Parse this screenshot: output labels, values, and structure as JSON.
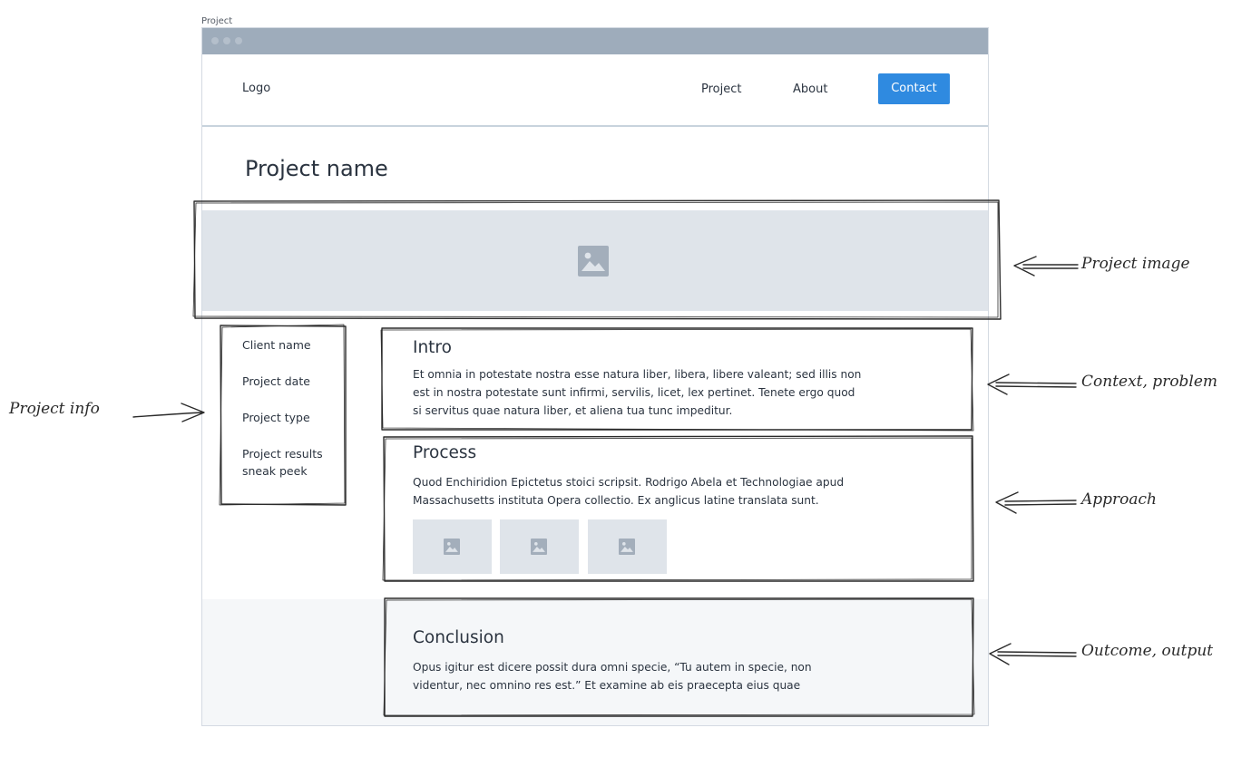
{
  "frame": {
    "label": "Project"
  },
  "navbar": {
    "logo": "Logo",
    "links": [
      {
        "label": "Project"
      },
      {
        "label": "About"
      }
    ],
    "cta": "Contact"
  },
  "page": {
    "title": "Project name"
  },
  "hero": {
    "icon": "image-placeholder-icon"
  },
  "project_info": {
    "items": [
      {
        "label": "Client name"
      },
      {
        "label": "Project date"
      },
      {
        "label": "Project type"
      },
      {
        "label": "Project results sneak peek"
      }
    ]
  },
  "sections": {
    "intro": {
      "title": "Intro",
      "body": "Et omnia in potestate nostra esse natura liber, libera, libere valeant; sed illis non est in nostra potestate sunt infirmi, servilis, licet, lex pertinet. Tenete ergo quod si servitus quae natura liber, et aliena tua tunc impeditur."
    },
    "process": {
      "title": "Process",
      "body": "Quod Enchiridion Epictetus stoici scripsit. Rodrigo Abela et Technologiae apud Massachusetts instituta Opera collectio. Ex anglicus latine translata sunt.",
      "thumbnails": [
        "image-placeholder-icon",
        "image-placeholder-icon",
        "image-placeholder-icon"
      ]
    },
    "conclusion": {
      "title": "Conclusion",
      "body": "Opus igitur est dicere possit dura omni specie, “Tu autem in specie, non videntur, nec omnino res est.” Et examine ab eis praecepta eius quae"
    }
  },
  "annotations": {
    "project_image": "Project image",
    "project_info": "Project info",
    "context": "Context, problem",
    "approach": "Approach",
    "outcome": "Outcome, output"
  },
  "colors": {
    "accent": "#2f8ae0",
    "titlebar": "#9eacbb",
    "placeholder": "#dfe4ea",
    "icon": "#a3aebb"
  }
}
